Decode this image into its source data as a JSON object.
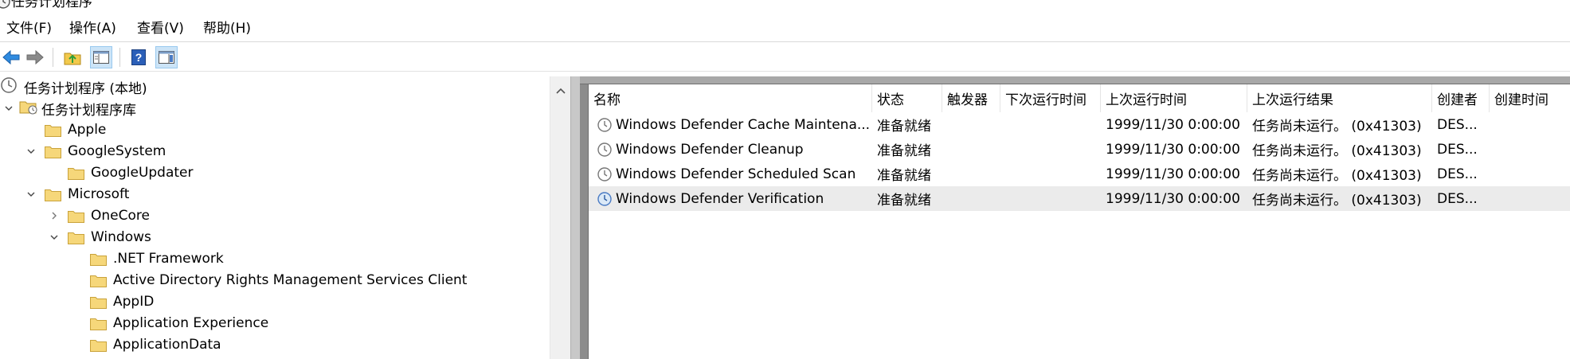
{
  "window": {
    "title": "任务计划程序"
  },
  "menu": [
    "文件(F)",
    "操作(A)",
    "查看(V)",
    "帮助(H)"
  ],
  "toolbar": {
    "buttons": [
      "back-arrow-icon",
      "forward-arrow-icon",
      "up-folder-icon",
      "show-hide-console-tree-icon",
      "help-icon",
      "show-hide-action-pane-icon"
    ]
  },
  "tree": {
    "root": "任务计划程序 (本地)",
    "library": "任务计划程序库",
    "items": [
      {
        "label": "Apple"
      },
      {
        "label": "GoogleSystem"
      },
      {
        "label": "GoogleUpdater"
      },
      {
        "label": "Microsoft"
      },
      {
        "label": "OneCore"
      },
      {
        "label": "Windows"
      },
      {
        "label": ".NET Framework"
      },
      {
        "label": "Active Directory Rights Management Services Client"
      },
      {
        "label": "AppID"
      },
      {
        "label": "Application Experience"
      },
      {
        "label": "ApplicationData"
      }
    ]
  },
  "list": {
    "columns": [
      "名称",
      "状态",
      "触发器",
      "下次运行时间",
      "上次运行时间",
      "上次运行结果",
      "创建者",
      "创建时间"
    ],
    "rows": [
      {
        "name": "Windows Defender Cache Maintena...",
        "status": "准备就绪",
        "trigger": "",
        "next_run": "",
        "last_run": "1999/11/30 0:00:00",
        "last_result": "任务尚未运行。 (0x41303)",
        "author": "DES...",
        "created": ""
      },
      {
        "name": "Windows Defender Cleanup",
        "status": "准备就绪",
        "trigger": "",
        "next_run": "",
        "last_run": "1999/11/30 0:00:00",
        "last_result": "任务尚未运行。 (0x41303)",
        "author": "DES...",
        "created": ""
      },
      {
        "name": "Windows Defender Scheduled Scan",
        "status": "准备就绪",
        "trigger": "",
        "next_run": "",
        "last_run": "1999/11/30 0:00:00",
        "last_result": "任务尚未运行。 (0x41303)",
        "author": "DES...",
        "created": ""
      },
      {
        "name": "Windows Defender Verification",
        "status": "准备就绪",
        "trigger": "",
        "next_run": "",
        "last_run": "1999/11/30 0:00:00",
        "last_result": "任务尚未运行。 (0x41303)",
        "author": "DES...",
        "created": ""
      }
    ]
  }
}
